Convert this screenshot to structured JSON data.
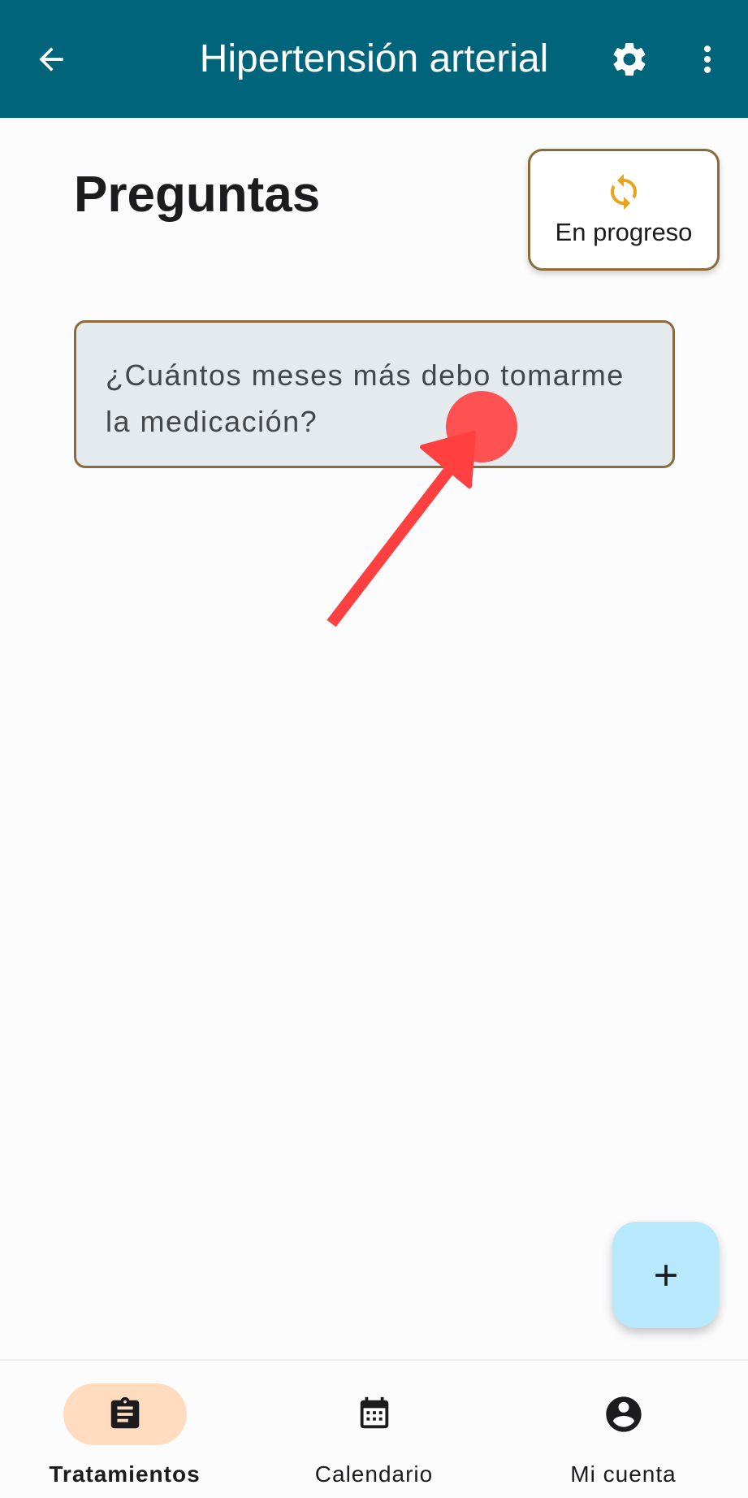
{
  "appbar": {
    "title": "Hipertensión arterial",
    "back_icon": "arrow-left-icon",
    "settings_icon": "gear-icon",
    "more_icon": "more-vert-icon"
  },
  "page": {
    "heading": "Preguntas"
  },
  "status": {
    "label": "En progreso",
    "icon": "sync-icon",
    "icon_color": "#e9a31c"
  },
  "questions": [
    {
      "text": "¿Cuántos meses más debo tomarme la medicación?"
    }
  ],
  "fab": {
    "icon": "plus-icon"
  },
  "bottom_nav": {
    "items": [
      {
        "label": "Tratamientos",
        "icon": "clipboard-icon",
        "active": true
      },
      {
        "label": "Calendario",
        "icon": "calendar-icon",
        "active": false
      },
      {
        "label": "Mi cuenta",
        "icon": "account-circle-icon",
        "active": false
      }
    ]
  },
  "colors": {
    "appbar": "#00657a",
    "accent_border": "#8b6b3c",
    "card_bg": "#e4eaee",
    "fab_bg": "#b8e8fb",
    "active_nav_pill": "#ffdcc0",
    "annotation": "#ff4040"
  }
}
